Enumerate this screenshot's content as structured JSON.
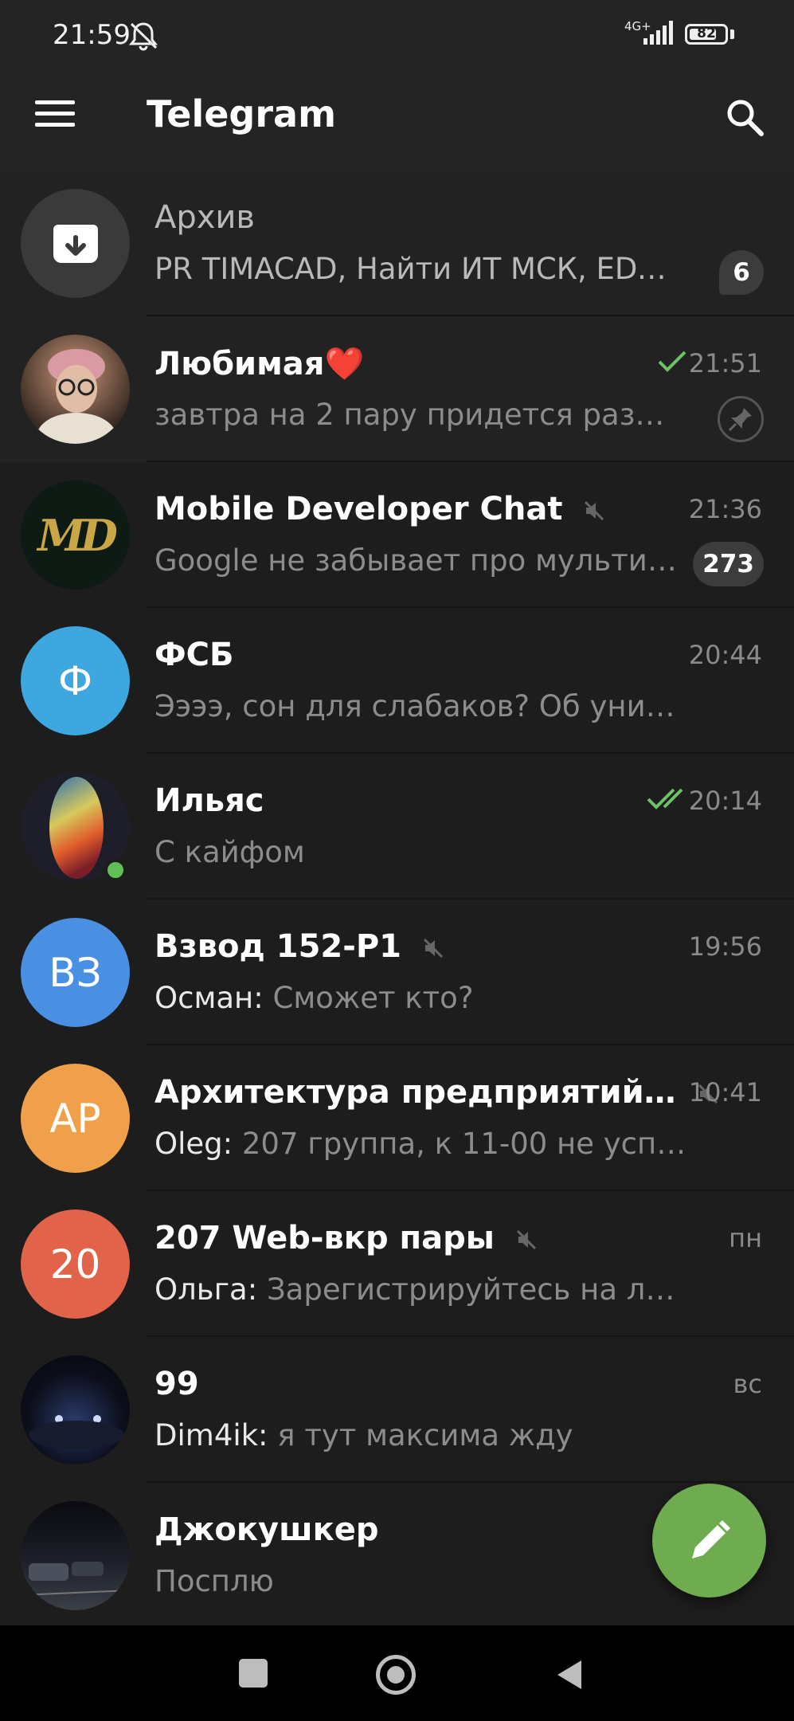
{
  "status_bar": {
    "time": "21:59",
    "network": "4G+",
    "battery": "82",
    "battery_level": 0.82
  },
  "app_bar": {
    "title": "Telegram"
  },
  "chats": [
    {
      "id": "archive",
      "name": "Архив",
      "preview": "PR TIMACAD, Найти ИТ МСК, EDA…",
      "badge": "6",
      "avatar_icon": "archive-icon",
      "avatar_color": "#3a3a3a"
    },
    {
      "id": "lyubimaya",
      "name": "Любимая❤️",
      "time": "21:51",
      "preview": "завтра на 2 пару придется разду…",
      "status": "sent",
      "pinned": true,
      "avatar_color": "#6b5a4f"
    },
    {
      "id": "mdc",
      "name": "Mobile Developer Chat",
      "muted": true,
      "time": "21:36",
      "preview": "Google не забывает про мульти…",
      "badge": "273",
      "avatar_text": "MD",
      "avatar_color": "#0e1a14"
    },
    {
      "id": "fsb",
      "name": "ФСБ",
      "time": "20:44",
      "preview": "Ээээ, сон для слабаков? Об универе…",
      "avatar_text": "Ф",
      "avatar_color": "#3ea7e0"
    },
    {
      "id": "ilyas",
      "name": "Ильяс",
      "time": "20:14",
      "preview": "С кайфом",
      "status": "read",
      "online": true,
      "avatar_color": "#2b2b38"
    },
    {
      "id": "vzvod",
      "name": "Взвод 152-Р1",
      "muted": true,
      "time": "19:56",
      "sender": "Осман:",
      "preview": "Сможет кто?",
      "avatar_text": "ВЗ",
      "avatar_color": "#4a90e2"
    },
    {
      "id": "arch",
      "name": "Архитектура предприятий…",
      "muted": true,
      "time": "10:41",
      "sender": "Oleg:",
      "preview": "207 группа, к 11-00 не успеваю.…",
      "avatar_text": "АР",
      "avatar_color": "#f0a04b"
    },
    {
      "id": "web",
      "name": "207 Web-вкр пары",
      "muted": true,
      "time": "пн",
      "sender": "Ольга:",
      "preview": "Зарегистрируйтесь на лидер i…",
      "avatar_text": "20",
      "avatar_color": "#e0634a"
    },
    {
      "id": "99",
      "name": "99",
      "time": "вс",
      "sender": "Dim4ik:",
      "preview": "я тут максима жду",
      "avatar_color": "#0c0f1c"
    },
    {
      "id": "jokushker",
      "name": "Джокушкер",
      "time": "",
      "preview": "Посплю",
      "avatar_color": "#14161d"
    }
  ],
  "fab": {
    "icon": "pencil-icon",
    "color": "#6fac4f"
  },
  "nav": {
    "recents_icon": "square-icon",
    "home_icon": "circle-icon",
    "back_icon": "triangle-back-icon"
  }
}
